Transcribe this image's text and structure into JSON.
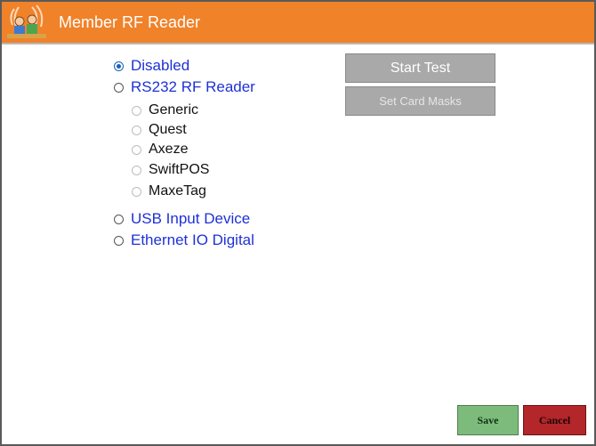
{
  "window": {
    "title": "Member RF Reader"
  },
  "reader_options": [
    {
      "label": "Disabled",
      "checked": true
    },
    {
      "label": "RS232 RF Reader",
      "checked": false
    },
    {
      "label": "USB Input Device",
      "checked": false
    },
    {
      "label": "Ethernet IO Digital",
      "checked": false
    }
  ],
  "rs232_types": [
    {
      "label": "Generic"
    },
    {
      "label": "Quest"
    },
    {
      "label": "Axeze"
    },
    {
      "label": "SwiftPOS"
    },
    {
      "label": "MaxeTag"
    }
  ],
  "actions": {
    "start_test": "Start Test",
    "set_card_masks": "Set Card Masks",
    "save": "Save",
    "cancel": "Cancel"
  },
  "colors": {
    "title_bar": "#f0822a",
    "option_text": "#1f30d6",
    "save": "#7dbb7d",
    "cancel": "#b3262a",
    "disabled_button": "#a9a9a9"
  }
}
